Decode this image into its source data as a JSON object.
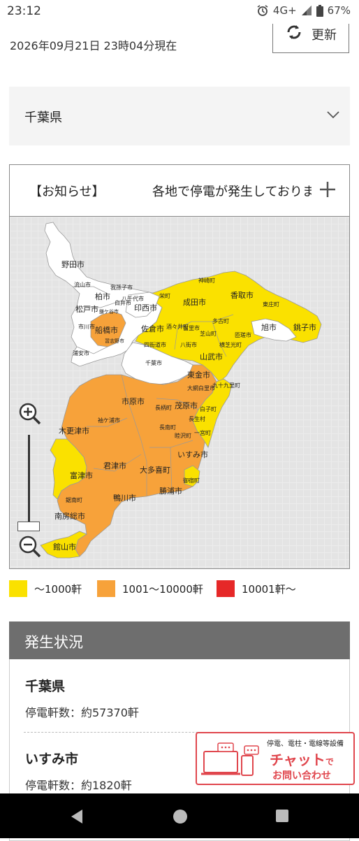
{
  "status_bar": {
    "time": "23:12",
    "network": "4G+",
    "battery": "67%"
  },
  "header": {
    "timestamp": "2026年09月21日 23時04分現在",
    "refresh_label": "更新"
  },
  "prefecture_select": {
    "selected": "千葉県"
  },
  "notice": {
    "title": "【お知らせ】",
    "text": "各地で停電が発生しております"
  },
  "map": {
    "colors": {
      "none": "#ffffff",
      "low": "#fae100",
      "mid": "#f7a23a",
      "high": "#e62828"
    },
    "labels": {
      "noda": "野田市",
      "nagareyama": "流山市",
      "kashiwa": "柏市",
      "abiko": "我孫子市",
      "matsudo": "松戸市",
      "kamagaya": "鎌ケ谷市",
      "shiroi": "白井市",
      "ichikawa": "市川市",
      "funabashi": "船橋市",
      "yachiyo": "八千代市",
      "urayasu": "浦安市",
      "narashino": "習志野市",
      "inzai": "印西市",
      "sakae": "栄町",
      "narita": "成田市",
      "katori": "香取市",
      "kozaki": "神崎町",
      "tonosho": "東庄町",
      "asahi": "旭市",
      "choshi": "銚子市",
      "sakura": "佐倉市",
      "shisui": "酒々井町",
      "tomisato": "富里市",
      "tako": "多古町",
      "shibayama": "芝山町",
      "sosa": "匝瑳市",
      "yokoshibahikari": "横芝光町",
      "yotsukaido": "四街道市",
      "chiba": "千葉市",
      "sammu": "山武市",
      "yachimata": "八街市",
      "togane": "東金市",
      "oamishirasato": "大網白里市",
      "kujukuri": "九十九里町",
      "ichihara": "市原市",
      "mobara": "茂原市",
      "nagara": "長柄町",
      "chosei": "長生村",
      "shirako": "白子町",
      "sodegaura": "袖ケ浦市",
      "kisarazu": "木更津市",
      "nagaraminami": "長南町",
      "mutsuzawa": "睦沢町",
      "ichinomiya": "一宮町",
      "kimitsu": "君津市",
      "otaki": "大多喜町",
      "isumi": "いすみ市",
      "futtsu": "富津市",
      "onjuku": "御宿町",
      "katsuura": "勝浦市",
      "kamogawa": "鴨川市",
      "kyonan": "鋸南町",
      "minamiboso": "南房総市",
      "tateyama": "館山市"
    }
  },
  "legend": [
    {
      "label": "〜1000軒",
      "color": "#fae100"
    },
    {
      "label": "1001〜10000軒",
      "color": "#f7a23a"
    },
    {
      "label": "10001軒〜",
      "color": "#e62828"
    }
  ],
  "status_panel": {
    "heading": "発生状況",
    "areas": [
      {
        "name": "千葉県",
        "count": "停電軒数：約57370軒"
      },
      {
        "name": "いすみ市",
        "count": "停電軒数：約1820軒"
      }
    ]
  },
  "chat_banner": {
    "small": "停電、電柱・電線等設備",
    "big": "チャット",
    "de": "で",
    "sub": "お問い合わせ"
  }
}
